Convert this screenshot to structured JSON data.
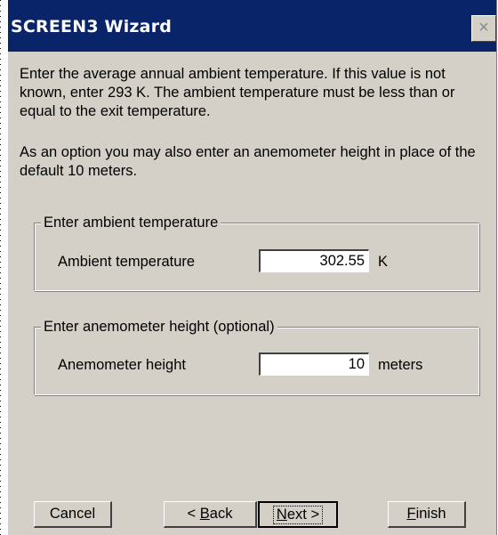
{
  "window": {
    "title": "SCREEN3 Wizard",
    "close_label": "×"
  },
  "instructions": {
    "paragraph1": "Enter the average annual ambient temperature. If this value is not known, enter 293 K.  The ambient temperature must be less than or equal to the exit temperature.",
    "paragraph2": "As an option you may also enter an anemometer height in place of the default 10 meters."
  },
  "ambient_group": {
    "legend": "Enter ambient temperature",
    "label": "Ambient temperature",
    "value": "302.55",
    "unit": "K"
  },
  "anemometer_group": {
    "legend": "Enter anemometer height (optional)",
    "label": "Anemometer height",
    "value": "10",
    "unit": "meters"
  },
  "buttons": {
    "cancel": "Cancel",
    "back_prefix": "< ",
    "back_mnemonic": "B",
    "back_rest": "ack",
    "next_mnemonic": "N",
    "next_rest": "ext >",
    "finish_mnemonic": "F",
    "finish_rest": "inish"
  },
  "colors": {
    "titlebar": "#0a246a",
    "dialog_face": "#d4d0c8"
  }
}
